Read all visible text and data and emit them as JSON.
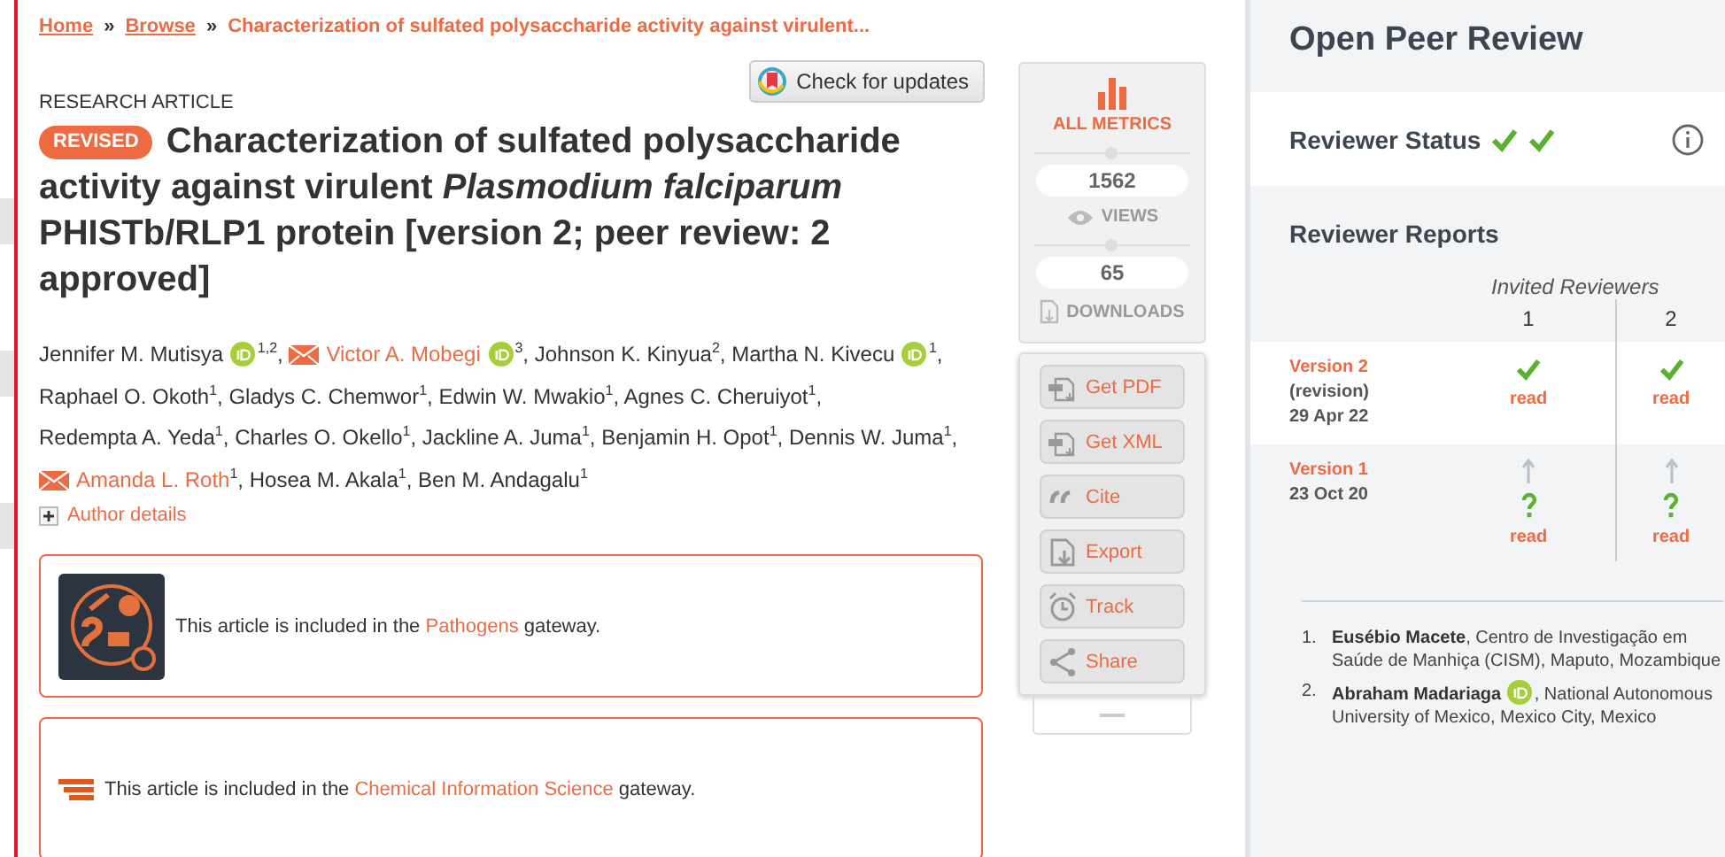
{
  "breadcrumb": {
    "separator": "»",
    "items": [
      {
        "label": "Home",
        "kind": "link"
      },
      {
        "label": "Browse",
        "kind": "link"
      },
      {
        "label": "Characterization of sulfated polysaccharide activity against virulent...",
        "kind": "current"
      }
    ]
  },
  "check_updates": {
    "label": "Check for updates"
  },
  "article_type": "RESEARCH ARTICLE",
  "badge": "REVISED",
  "title": "Characterization of sulfated polysaccharide activity against virulent *Plasmodium falciparum* PHISTb/RLP1 protein [version 2; peer review: 2 approved]",
  "authors": [
    {
      "name": "Jennifer M. Mutisya",
      "affil": "1,2",
      "orcid": true,
      "corresponding": false
    },
    {
      "name": "Victor A. Mobegi",
      "affil": "3",
      "orcid": true,
      "corresponding": true
    },
    {
      "name": "Johnson K. Kinyua",
      "affil": "2",
      "orcid": false,
      "corresponding": false
    },
    {
      "name": "Martha N. Kivecu",
      "affil": "1",
      "orcid": true,
      "corresponding": false
    },
    {
      "name": "Raphael O. Okoth",
      "affil": "1",
      "orcid": false,
      "corresponding": false
    },
    {
      "name": "Gladys C. Chemwor",
      "affil": "1",
      "orcid": false,
      "corresponding": false
    },
    {
      "name": "Edwin W. Mwakio",
      "affil": "1",
      "orcid": false,
      "corresponding": false
    },
    {
      "name": "Agnes C. Cheruiyot",
      "affil": "1",
      "orcid": false,
      "corresponding": false
    },
    {
      "name": "Redempta A. Yeda",
      "affil": "1",
      "orcid": false,
      "corresponding": false
    },
    {
      "name": "Charles O. Okello",
      "affil": "1",
      "orcid": false,
      "corresponding": false
    },
    {
      "name": "Jackline A. Juma",
      "affil": "1",
      "orcid": false,
      "corresponding": false
    },
    {
      "name": "Benjamin H. Opot",
      "affil": "1",
      "orcid": false,
      "corresponding": false
    },
    {
      "name": "Dennis W. Juma",
      "affil": "1",
      "orcid": false,
      "corresponding": false
    },
    {
      "name": "Amanda L. Roth",
      "affil": "1",
      "orcid": false,
      "corresponding": true
    },
    {
      "name": "Hosea M. Akala",
      "affil": "1",
      "orcid": false,
      "corresponding": false
    },
    {
      "name": "Ben M. Andagalu",
      "affil": "1",
      "orcid": false,
      "corresponding": false
    }
  ],
  "author_separator": ",",
  "author_details": "Author details",
  "gateways": [
    {
      "kind": "pathogens",
      "before": "This article is included in the",
      "link": "Pathogens",
      "after": "gateway."
    },
    {
      "kind": "chemical",
      "before": "This article is included in the",
      "link": "Chemical Information Science",
      "after": "gateway."
    }
  ],
  "metrics": {
    "label": "ALL METRICS",
    "stats": [
      {
        "kind": "views",
        "value": "1562",
        "label": "VIEWS"
      },
      {
        "kind": "downloads",
        "value": "65",
        "label": "DOWNLOADS"
      }
    ]
  },
  "actions": [
    {
      "kind": "pdf",
      "label": "Get PDF"
    },
    {
      "kind": "xml",
      "label": "Get XML"
    },
    {
      "kind": "cite",
      "label": "Cite"
    },
    {
      "kind": "export",
      "label": "Export"
    },
    {
      "kind": "track",
      "label": "Track"
    },
    {
      "kind": "share",
      "label": "Share"
    }
  ],
  "peer_review": {
    "title": "Open Peer Review",
    "status_label": "Reviewer Status",
    "statuses": [
      {
        "approved": true
      },
      {
        "approved": true
      }
    ],
    "reports_title": "Reviewer Reports",
    "invited_label": "Invited Reviewers",
    "reviewers": [
      "1",
      "2"
    ],
    "versions": [
      {
        "label": "Version 2",
        "note": "(revision)",
        "date": "29 Apr 22",
        "current": true,
        "reports": [
          {
            "approved": true,
            "link": "read"
          },
          {
            "approved": true,
            "link": "read"
          }
        ]
      },
      {
        "label": "Version 1",
        "date": "23 Oct 20",
        "current": false,
        "reports": [
          {
            "approved": false,
            "link": "read"
          },
          {
            "approved": false,
            "link": "read"
          }
        ]
      }
    ],
    "reviewer_list": [
      {
        "number": "1.",
        "name": "Eusébio Macete",
        "orcid": false,
        "affiliation": ", Centro de Investigação em Saúde de Manhiça (CISM), Maputo, Mozambique"
      },
      {
        "number": "2.",
        "name": "Abraham Madariaga",
        "orcid": true,
        "affiliation": ", National Autonomous University of Mexico, Mexico City, Mexico"
      }
    ]
  }
}
